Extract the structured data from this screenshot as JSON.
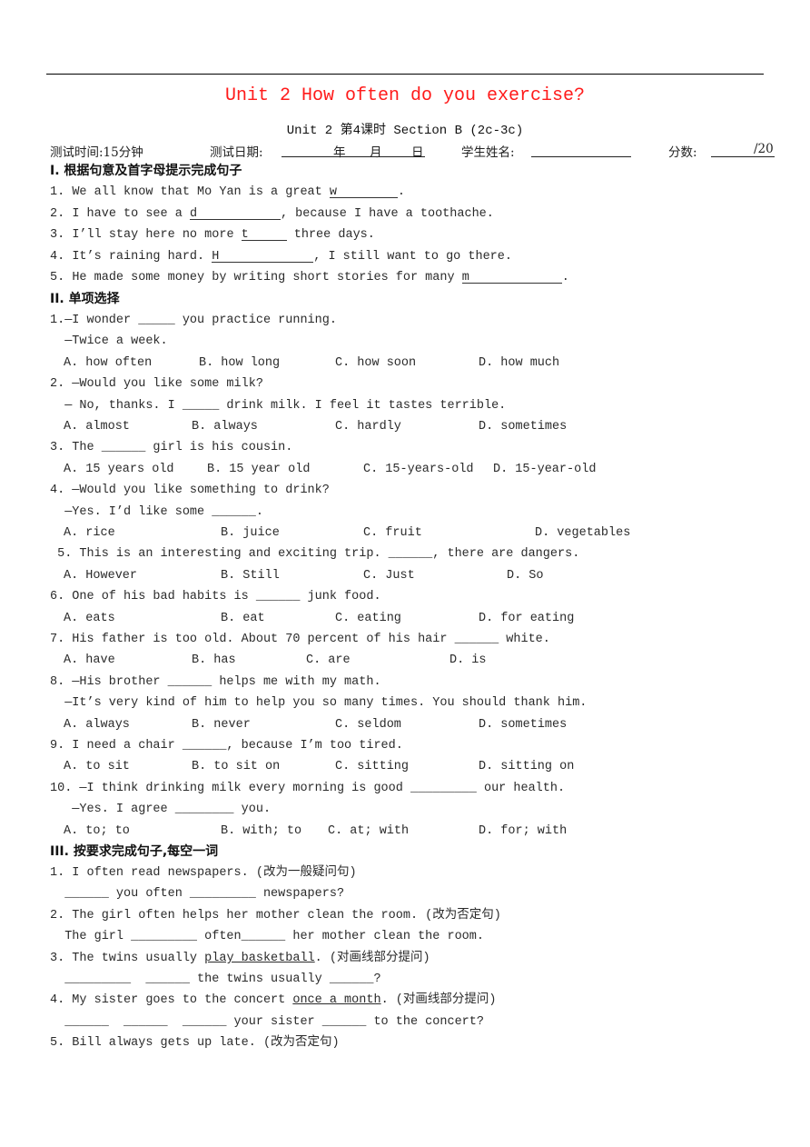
{
  "header": {
    "title": "Unit 2 How often do you exercise?",
    "subtitle": "Unit 2 第4课时 Section B (2c-3c)",
    "title_color": "#ff1a1a",
    "meta": {
      "time_label": "测试时间:15分钟",
      "date_label": "测试日期:",
      "year": "年",
      "month": "月",
      "day": "日",
      "name_label": "学生姓名:",
      "score_label": "分数:",
      "score_total": "/20"
    }
  },
  "section1": {
    "heading": "I. 根据句意及首字母提示完成句子",
    "items": [
      {
        "num": "1.",
        "before": "We all know that Mo Yan is a great ",
        "hint": "w",
        "after": "."
      },
      {
        "num": "2.",
        "before": "I have to see a ",
        "hint": "d",
        "after": ", because I have a toothache."
      },
      {
        "num": "3.",
        "before": "I’ll stay here no more ",
        "hint": "t",
        "after": " three days."
      },
      {
        "num": "4.",
        "before": "It’s raining hard. ",
        "hint": "H",
        "after": ", I still want to go there."
      },
      {
        "num": "5.",
        "before": "He made some money by writing short stories for many ",
        "hint": "m",
        "after": "."
      }
    ]
  },
  "section2": {
    "heading": "II. 单项选择",
    "questions": [
      {
        "lines": [
          "1.—I wonder _____ you practice running.",
          "  —Twice a week."
        ],
        "options": [
          "A. how often",
          "B. how long",
          "C. how soon",
          "D. how much"
        ]
      },
      {
        "lines": [
          "2. —Would you like some milk?",
          "  — No, thanks. I _____ drink milk. I feel it tastes terrible."
        ],
        "options": [
          "A. almost",
          "B. always",
          "C. hardly",
          "D. sometimes"
        ]
      },
      {
        "lines": [
          "3. The ______ girl is his cousin."
        ],
        "options": [
          "A. 15 years old",
          "B. 15 year old",
          "C. 15-years-old",
          "D. 15-year-old"
        ]
      },
      {
        "lines": [
          "4. —Would you like something to drink?",
          "  —Yes. I’d like some ______."
        ],
        "options": [
          "A. rice",
          "B. juice",
          "C. fruit",
          "D. vegetables"
        ]
      },
      {
        "lines": [
          " 5. This is an interesting and exciting trip. ______, there are dangers."
        ],
        "options": [
          "A. However",
          "B. Still",
          "C. Just",
          "D. So"
        ]
      },
      {
        "lines": [
          "6. One of his bad habits is ______ junk food."
        ],
        "options": [
          "A. eats",
          "B. eat",
          "C. eating",
          "D. for eating"
        ]
      },
      {
        "lines": [
          "7. His father is too old. About 70 percent of his hair ______ white."
        ],
        "options": [
          "A. have",
          "B. has",
          "C. are",
          "D. is"
        ]
      },
      {
        "lines": [
          "8. —His brother ______ helps me with my math.",
          "  —It’s very kind of him to help you so many times. You should thank him."
        ],
        "options": [
          "A. always",
          "B. never",
          "C. seldom",
          "D. sometimes"
        ]
      },
      {
        "lines": [
          "9. I need a chair ______, because I’m too tired."
        ],
        "options": [
          "A. to sit",
          "B. to sit on",
          "C. sitting",
          "D. sitting on"
        ]
      },
      {
        "lines": [
          "10. —I think drinking milk every morning is good _________ our health.",
          "   —Yes. I agree ________ you."
        ],
        "options": [
          "A. to; to",
          "B. with; to",
          "C. at; with",
          "D. for; with"
        ]
      }
    ]
  },
  "section3": {
    "heading": "III. 按要求完成句子,每空一词",
    "items": [
      {
        "prompt_before": "1. I often read newspapers. (改为一般疑问句)",
        "prompt_underlined": "",
        "prompt_after": "",
        "answer": "  ______ you often _________ newspapers?"
      },
      {
        "prompt_before": "2. The girl often helps her mother clean the room. (改为否定句)",
        "prompt_underlined": "",
        "prompt_after": "",
        "answer": "  The girl _________ often______ her mother clean the room."
      },
      {
        "prompt_before": "3. The twins usually ",
        "prompt_underlined": "play basketball",
        "prompt_after": ". (对画线部分提问)",
        "answer": "  _________  ______ the twins usually ______?"
      },
      {
        "prompt_before": "4. My sister goes to the concert ",
        "prompt_underlined": "once a month",
        "prompt_after": ". (对画线部分提问)",
        "answer": "  ______  ______  ______ your sister ______ to the concert?"
      },
      {
        "prompt_before": "5. Bill always gets up late. (改为否定句)",
        "prompt_underlined": "",
        "prompt_after": "",
        "answer": ""
      }
    ]
  }
}
